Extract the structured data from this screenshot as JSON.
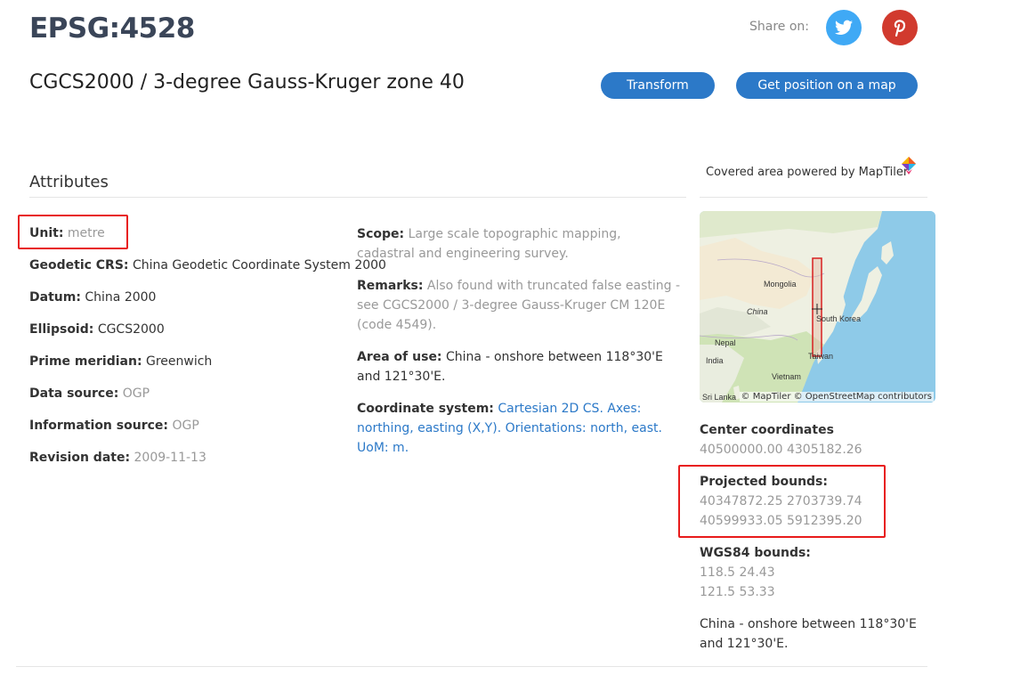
{
  "header": {
    "code": "EPSG:4528",
    "name": "CGCS2000 / 3-degree Gauss-Kruger zone 40",
    "share_label": "Share on:",
    "transform_label": "Transform",
    "get_position_label": "Get position on a map"
  },
  "attributes": {
    "title": "Attributes",
    "left": [
      {
        "label": "Unit:",
        "value": "metre",
        "muted": true
      },
      {
        "label": "Geodetic CRS:",
        "value": "China Geodetic Coordinate System 2000",
        "muted": false
      },
      {
        "label": "Datum:",
        "value": "China 2000",
        "muted": false
      },
      {
        "label": "Ellipsoid:",
        "value": "CGCS2000",
        "muted": false
      },
      {
        "label": "Prime meridian:",
        "value": "Greenwich",
        "muted": false
      },
      {
        "label": "Data source:",
        "value": "OGP",
        "muted": true
      },
      {
        "label": "Information source:",
        "value": "OGP",
        "muted": true
      },
      {
        "label": "Revision date:",
        "value": "2009-11-13",
        "muted": true
      }
    ],
    "scope_label": "Scope:",
    "scope_value": "Large scale topographic mapping, cadastral and engineering survey.",
    "remarks_label": "Remarks:",
    "remarks_value": "Also found with truncated false easting - see CGCS2000 / 3-degree Gauss-Kruger CM 120E (code 4549).",
    "area_label": "Area of use:",
    "area_value": "China - onshore between 118°30'E and 121°30'E.",
    "cs_label": "Coordinate system:",
    "cs_value": "Cartesian 2D CS. Axes: northing, easting (X,Y). Orientations: north, east. UoM: m."
  },
  "sidebar": {
    "covered_label": "Covered area powered by MapTiler",
    "map_labels": {
      "mongolia": "Mongolia",
      "china": "China",
      "south_korea": "South Korea",
      "nepal": "Nepal",
      "india": "India",
      "taiwan": "Taiwan",
      "vietnam": "Vietnam",
      "sri_lanka": "Sri Lanka"
    },
    "attribution": "© MapTiler © OpenStreetMap contributors",
    "center_label": "Center coordinates",
    "center_value": "40500000.00 4305182.26",
    "projected_label": "Projected bounds:",
    "projected_min": "40347872.25 2703739.74",
    "projected_max": "40599933.05 5912395.20",
    "wgs_label": "WGS84 bounds:",
    "wgs_min": "118.5 24.43",
    "wgs_max": "121.5 53.33",
    "area_text": "China - onshore between 118°30'E and 121°30'E."
  },
  "icons": {
    "twitter": "twitter-icon",
    "pinterest": "pinterest-icon",
    "maptiler": "maptiler-logo-icon"
  },
  "colors": {
    "accent": "#2c79c8",
    "highlight": "#e81c1c",
    "twitter": "#3fa9f5",
    "pinterest": "#d13a2e"
  }
}
